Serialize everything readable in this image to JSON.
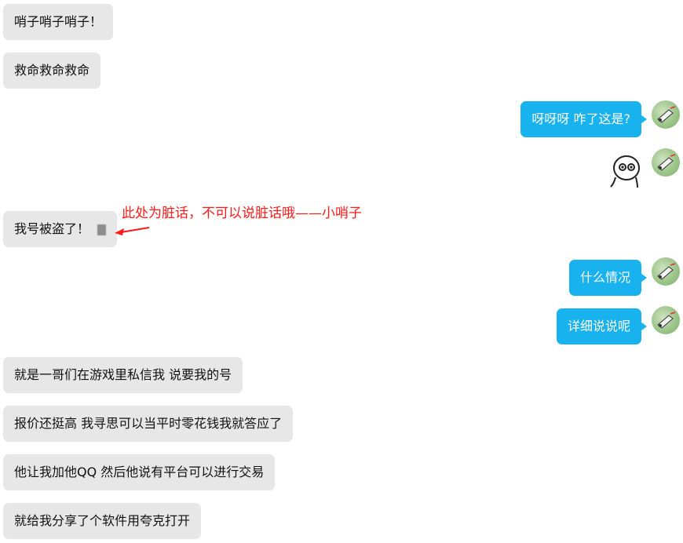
{
  "messages": [
    {
      "side": "left",
      "text": "哨子哨子哨子！"
    },
    {
      "side": "left",
      "text": "救命救命救命"
    },
    {
      "side": "right",
      "text": "呀呀呀 咋了这是?"
    },
    {
      "side": "right",
      "type": "sticker"
    },
    {
      "side": "left",
      "text": "我号被盗了！"
    },
    {
      "side": "right",
      "text": "什么情况"
    },
    {
      "side": "right",
      "text": "详细说说呢"
    },
    {
      "side": "left",
      "text": "就是一哥们在游戏里私信我 说要我的号"
    },
    {
      "side": "left",
      "text": "报价还挺高 我寻思可以当平时零花钱我就答应了"
    },
    {
      "side": "left",
      "text": "他让我加他QQ 然后他说有平台可以进行交易"
    },
    {
      "side": "left",
      "text": "就给我分享了个软件用夸克打开"
    }
  ],
  "annotation": {
    "text": "此处为脏话，不可以说脏话哦——小哨子",
    "color": "#ff1a1a"
  },
  "colors": {
    "left_bubble": "#e7e7e7",
    "right_bubble": "#18b2ef",
    "annotation": "#ff1a1a"
  }
}
